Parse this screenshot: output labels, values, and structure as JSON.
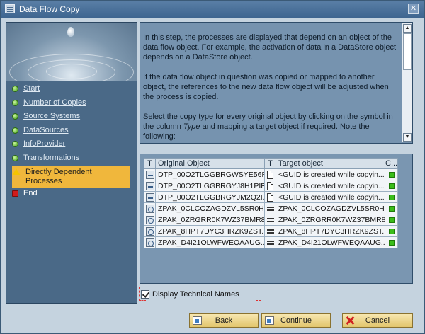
{
  "window": {
    "title": "Data Flow Copy",
    "close_glyph": "✕",
    "app_icon": "list-icon",
    "close_icon": "close-icon"
  },
  "nav": {
    "steps": [
      {
        "label": "Start",
        "status": "green",
        "link": true
      },
      {
        "label": "Number of Copies",
        "status": "green",
        "link": true
      },
      {
        "label": "Source Systems",
        "status": "green",
        "link": true
      },
      {
        "label": "DataSources",
        "status": "green",
        "link": true
      },
      {
        "label": "InfoProvider",
        "status": "green",
        "link": true
      },
      {
        "label": "Transformations",
        "status": "green",
        "link": true
      },
      {
        "label": "Directly Dependent Processes",
        "status": "warning",
        "link": false,
        "active": true
      },
      {
        "label": "End",
        "status": "red",
        "link": false
      }
    ]
  },
  "info": {
    "p1": "In this step, the processes are displayed that depend on an object of the data flow object. For example, the activation of data in a DataStore object depends on a DataStore object.",
    "p2": "If the data flow object in question was copied or mapped to another object, the references to the new data flow object will be adjusted when the process is copied.",
    "p3_pre": "Select the copy type for every original object by clicking on the symbol in the column ",
    "p3_em": "Type",
    "p3_post": " and mapping a target object if required. Note the following:"
  },
  "table": {
    "headers": {
      "t1": "T",
      "original": "Original Object",
      "t2": "T",
      "target": "Target object",
      "c": "C..."
    },
    "rows": [
      {
        "obj_icon": "dtp",
        "original": "DTP_00O2TLGGBRGWSYE56R...",
        "type": "doc",
        "target": "<GUID is created while copyin..."
      },
      {
        "obj_icon": "dtp",
        "original": "DTP_00O2TLGGBRGYJ8H1PIB...",
        "type": "doc",
        "target": "<GUID is created while copyin..."
      },
      {
        "obj_icon": "dtp",
        "original": "DTP_00O2TLGGBRGYJM2Q2I...",
        "type": "doc",
        "target": "<GUID is created while copyin..."
      },
      {
        "obj_icon": "zpak",
        "original": "ZPAK_0CLCOZAGDZVL5SR0HS...",
        "type": "eq",
        "target": "ZPAK_0CLCOZAGDZVL5SR0HS..."
      },
      {
        "obj_icon": "zpak",
        "original": "ZPAK_0ZRGRR0K7WZ37BMR8...",
        "type": "eq",
        "target": "ZPAK_0ZRGRR0K7WZ37BMR8..."
      },
      {
        "obj_icon": "zpak",
        "original": "ZPAK_8HPT7DYC3HRZK9ZST...",
        "type": "eq",
        "target": "ZPAK_8HPT7DYC3HRZK9ZST..."
      },
      {
        "obj_icon": "zpak",
        "original": "ZPAK_D4I21OLWFWEQAAUG...",
        "type": "eq",
        "target": "ZPAK_D4I21OLWFWEQAAUG..."
      }
    ]
  },
  "options": {
    "display_tech_names": "Display Technical Names",
    "display_tech_names_checked": true
  },
  "buttons": {
    "back": "Back",
    "continue": "Continue",
    "cancel": "Cancel"
  },
  "colors": {
    "accent": "#f0b73c",
    "status_ok": "#3bbd1a",
    "title_bar": "#3e6590"
  }
}
